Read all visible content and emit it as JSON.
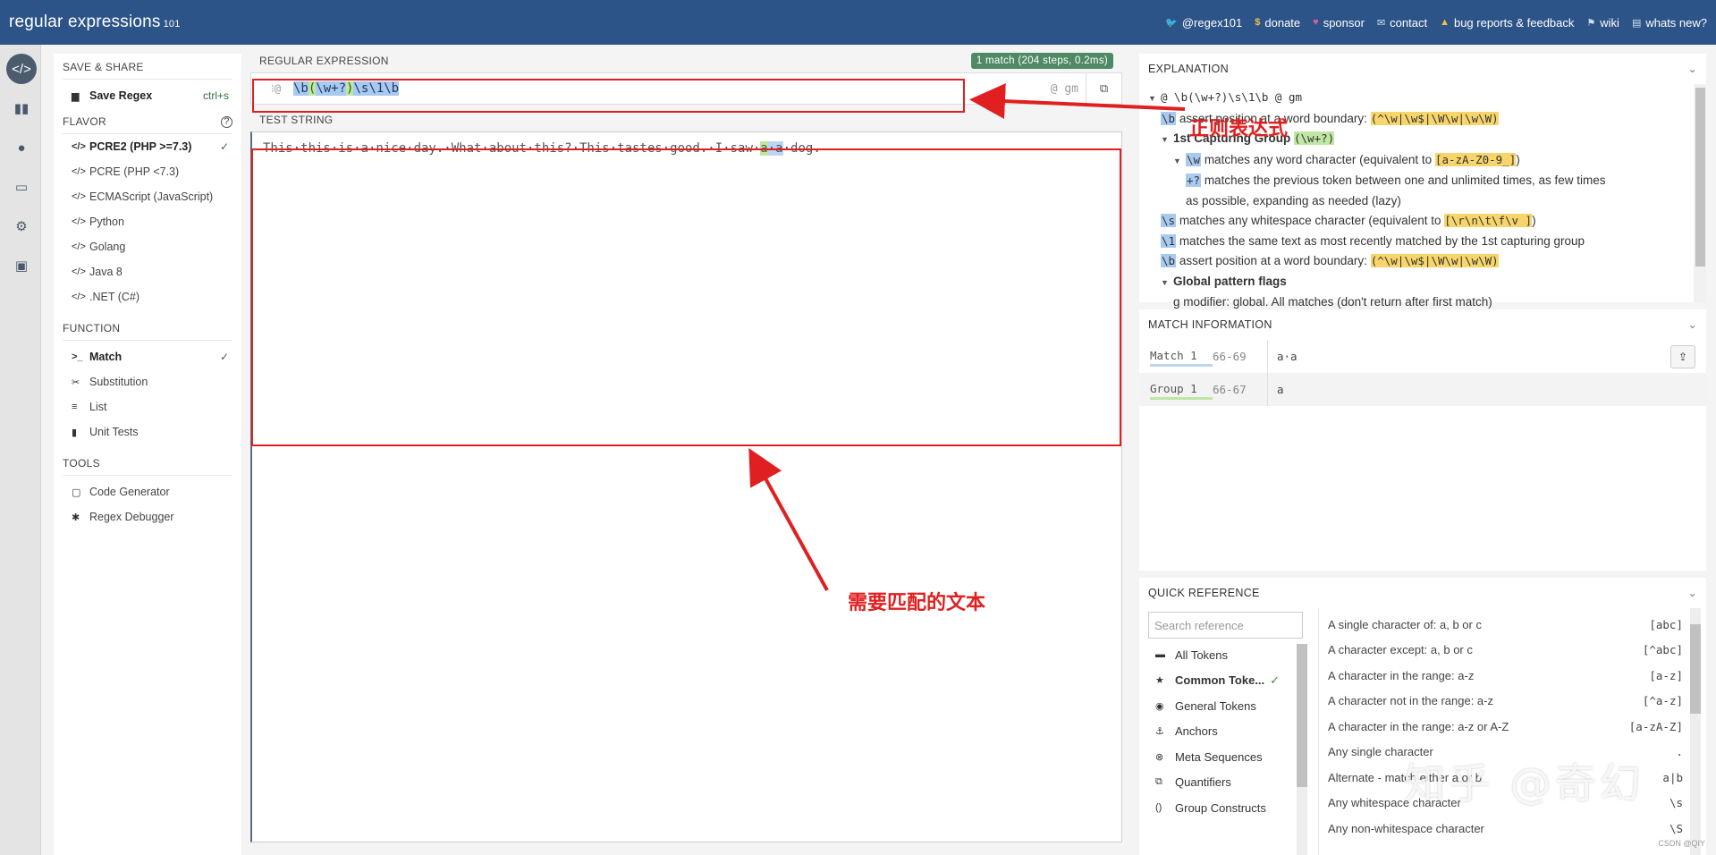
{
  "topbar": {
    "brand_main": "regular",
    "brand_second": " expressions",
    "brand_version": "101",
    "links": [
      {
        "icon": "twitter-icon",
        "label": "@regex101"
      },
      {
        "icon": "dollar-icon",
        "label": "donate"
      },
      {
        "icon": "heart-icon",
        "label": "sponsor"
      },
      {
        "icon": "mail-icon",
        "label": "contact"
      },
      {
        "icon": "warning-icon",
        "label": "bug reports & feedback"
      },
      {
        "icon": "flag-icon",
        "label": "wiki"
      },
      {
        "icon": "newspaper-icon",
        "label": "whats new?"
      }
    ]
  },
  "sidebar": {
    "save_share_title": "SAVE & SHARE",
    "save_regex": "Save Regex",
    "save_shortcut": "ctrl+s",
    "flavor_title": "FLAVOR",
    "flavors": [
      "PCRE2 (PHP >=7.3)",
      "PCRE (PHP <7.3)",
      "ECMAScript (JavaScript)",
      "Python",
      "Golang",
      "Java 8",
      ".NET (C#)"
    ],
    "function_title": "FUNCTION",
    "functions": [
      "Match",
      "Substitution",
      "List",
      "Unit Tests"
    ],
    "tools_title": "TOOLS",
    "tools": [
      "Code Generator",
      "Regex Debugger"
    ]
  },
  "editor": {
    "regex_title": "REGULAR EXPRESSION",
    "match_badge": "1 match (204 steps, 0.2ms)",
    "regex_prefix": "⁝@",
    "regex_tokens": [
      "\\b",
      "(",
      "\\w+?",
      ")",
      "\\s",
      "\\1",
      "\\b"
    ],
    "regex_flags": "@ gm",
    "test_title": "TEST STRING",
    "test_before": "This·this·is·a·nice·day.·What·about·this?·This·tastes·good.·I·saw·",
    "test_m1": "a",
    "test_mid": "·",
    "test_m2": "a",
    "test_after": "·dog."
  },
  "explanation": {
    "title": "EXPLANATION",
    "lines": [
      {
        "k": "root",
        "text": "@ \\b(\\w+?)\\s\\1\\b @ gm"
      },
      {
        "k": "l1",
        "tok": "\\b",
        "text": " assert position at a word boundary: ",
        "code": "(^\\w|\\w$|\\W\\w|\\w\\W)"
      },
      {
        "k": "l2",
        "text": "1st Capturing Group ",
        "code": "(\\w+?)"
      },
      {
        "k": "l3",
        "tok": "\\w",
        "text": " matches any word character (equivalent to ",
        "code": "[a-zA-Z0-9_]",
        "tail": ")"
      },
      {
        "k": "l4",
        "tok": "+?",
        "text": " matches the previous token between one and unlimited times, as few times"
      },
      {
        "k": "l5",
        "text": "as possible, expanding as needed (lazy)"
      },
      {
        "k": "l6",
        "tok": "\\s",
        "text": " matches any whitespace character (equivalent to ",
        "code": "[\\r\\n\\t\\f\\v ]",
        "tail": ")"
      },
      {
        "k": "l7",
        "tok": "\\1",
        "text": " matches the same text as most recently matched by the 1st capturing group"
      },
      {
        "k": "l8",
        "tok": "\\b",
        "text": " assert position at a word boundary: ",
        "code": "(^\\w|\\w$|\\W\\w|\\w\\W)"
      },
      {
        "k": "l9",
        "text": "Global pattern flags"
      },
      {
        "k": "l10",
        "text": "g modifier: global. All matches (don't return after first match)"
      }
    ]
  },
  "match_info": {
    "title": "MATCH INFORMATION",
    "rows": [
      {
        "label": "Match 1",
        "range": "66-69",
        "value": "a·a"
      },
      {
        "label": "Group 1",
        "range": "66-67",
        "value": "a"
      }
    ]
  },
  "quick_ref": {
    "title": "QUICK REFERENCE",
    "search_placeholder": "Search reference",
    "categories": [
      "All Tokens",
      "Common Toke...",
      "General Tokens",
      "Anchors",
      "Meta Sequences",
      "Quantifiers",
      "Group Constructs"
    ],
    "rows": [
      {
        "desc": "A single character of: a, b or c",
        "tok": "[abc]"
      },
      {
        "desc": "A character except: a, b or c",
        "tok": "[^abc]"
      },
      {
        "desc": "A character in the range: a-z",
        "tok": "[a-z]"
      },
      {
        "desc": "A character not in the range: a-z",
        "tok": "[^a-z]"
      },
      {
        "desc": "A character in the range: a-z or A-Z",
        "tok": "[a-zA-Z]"
      },
      {
        "desc": "Any single character",
        "tok": "."
      },
      {
        "desc": "Alternate - match either a or b",
        "tok": "a|b"
      },
      {
        "desc": "Any whitespace character",
        "tok": "\\s"
      },
      {
        "desc": "Any non-whitespace character",
        "tok": "\\S"
      }
    ]
  },
  "annotations": {
    "regex_label": "正则表达式",
    "text_label": "需要匹配的文本",
    "watermark": "知乎 @奇幻",
    "csdn": "CSDN @QIY"
  },
  "colors": {
    "topbar": "#2d5488",
    "annotation": "#e02020",
    "match_green": "#bfe6a2",
    "match_blue": "#a8c9f0"
  }
}
